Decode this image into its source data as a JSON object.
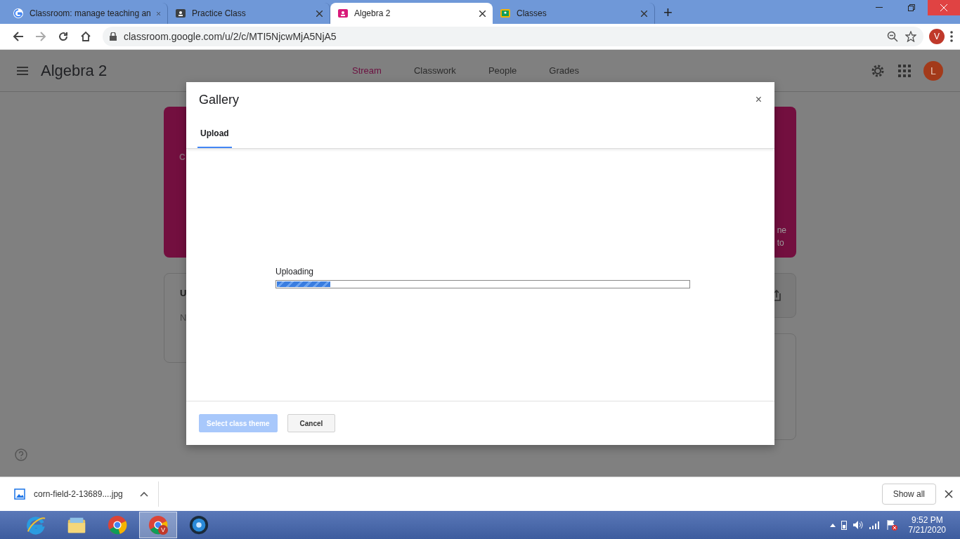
{
  "browser_tabs": [
    {
      "title": "Classroom: manage teaching an",
      "kind": "google",
      "selected": false
    },
    {
      "title": "Practice Class",
      "kind": "classroom-dark",
      "selected": false
    },
    {
      "title": "Algebra 2",
      "kind": "classroom-pink",
      "selected": true
    },
    {
      "title": "Classes",
      "kind": "classroom-green",
      "selected": false
    }
  ],
  "new_tab": "+",
  "address_bar": {
    "url": "classroom.google.com/u/2/c/MTI5NjcwMjA5NjA5"
  },
  "profile_avatar": "V",
  "app_header": {
    "title": "Algebra 2",
    "nav": [
      {
        "label": "Stream",
        "selected": true
      },
      {
        "label": "Classwork",
        "selected": false
      },
      {
        "label": "People",
        "selected": false
      },
      {
        "label": "Grades",
        "selected": false
      }
    ],
    "avatar": "L"
  },
  "background_fragments": {
    "banner_subtitle": "C",
    "banner_right_line_1": "ne",
    "banner_right_line_2": "to",
    "card_title": "U",
    "card_text": "N"
  },
  "dialog": {
    "title": "Gallery",
    "tabs": [
      {
        "label": "Upload",
        "selected": true
      }
    ],
    "progress": {
      "label": "Uploading",
      "level": 0.13
    },
    "buttons": [
      {
        "label": "Select class theme",
        "kind": "primary",
        "disabled": true
      },
      {
        "label": "Cancel",
        "kind": "secondary",
        "disabled": false
      }
    ],
    "close": "×"
  },
  "download_bar": {
    "file": "corn-field-2-13689....jpg",
    "show_all": "Show all"
  },
  "taskbar": {
    "apps": [
      {
        "kind": "ie",
        "active": false
      },
      {
        "kind": "explorer",
        "active": false
      },
      {
        "kind": "chrome",
        "active": false
      },
      {
        "kind": "chrome-profile",
        "active": true,
        "badge": "V"
      },
      {
        "kind": "disc",
        "active": false
      }
    ],
    "time": "9:52 PM",
    "date": "7/21/2020"
  }
}
